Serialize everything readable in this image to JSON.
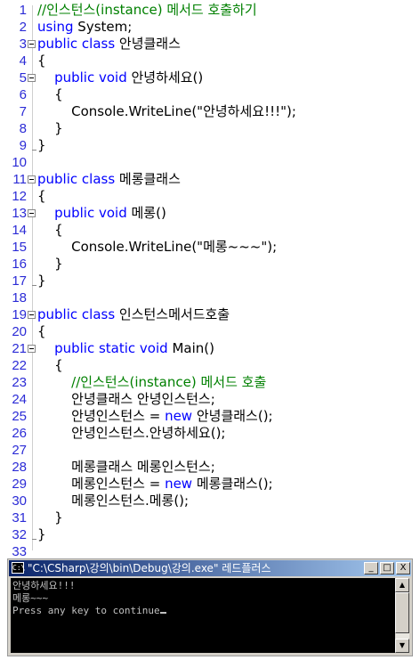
{
  "editor": {
    "lines": [
      {
        "n": "1",
        "parts": [
          {
            "t": "//인스턴스(instance) 메서드 호출하기",
            "c": "cm"
          }
        ]
      },
      {
        "n": "2",
        "parts": [
          {
            "t": "using",
            "c": "kw"
          },
          {
            "t": " System;"
          }
        ]
      },
      {
        "n": "3",
        "parts": [
          {
            "t": "public class",
            "c": "kw"
          },
          {
            "t": " 안녕클래스"
          }
        ]
      },
      {
        "n": "4",
        "parts": [
          {
            "t": "{"
          }
        ]
      },
      {
        "n": "5",
        "parts": [
          {
            "t": "    "
          },
          {
            "t": "public void",
            "c": "kw"
          },
          {
            "t": " 안녕하세요()"
          }
        ]
      },
      {
        "n": "6",
        "parts": [
          {
            "t": "    {"
          }
        ]
      },
      {
        "n": "7",
        "parts": [
          {
            "t": "        Console.WriteLine(\"안녕하세요!!!\");"
          }
        ]
      },
      {
        "n": "8",
        "parts": [
          {
            "t": "    }"
          }
        ]
      },
      {
        "n": "9",
        "parts": [
          {
            "t": "}"
          }
        ]
      },
      {
        "n": "10",
        "parts": []
      },
      {
        "n": "11",
        "parts": [
          {
            "t": "public class",
            "c": "kw"
          },
          {
            "t": " 메롱클래스"
          }
        ]
      },
      {
        "n": "12",
        "parts": [
          {
            "t": "{"
          }
        ]
      },
      {
        "n": "13",
        "parts": [
          {
            "t": "    "
          },
          {
            "t": "public void",
            "c": "kw"
          },
          {
            "t": " 메롱()"
          }
        ]
      },
      {
        "n": "14",
        "parts": [
          {
            "t": "    {"
          }
        ]
      },
      {
        "n": "15",
        "parts": [
          {
            "t": "        Console.WriteLine(\"메롱~~~\");"
          }
        ]
      },
      {
        "n": "16",
        "parts": [
          {
            "t": "    }"
          }
        ]
      },
      {
        "n": "17",
        "parts": [
          {
            "t": "}"
          }
        ]
      },
      {
        "n": "18",
        "parts": []
      },
      {
        "n": "19",
        "parts": [
          {
            "t": "public class",
            "c": "kw"
          },
          {
            "t": " 인스턴스메서드호출"
          }
        ]
      },
      {
        "n": "20",
        "parts": [
          {
            "t": "{"
          }
        ]
      },
      {
        "n": "21",
        "parts": [
          {
            "t": "    "
          },
          {
            "t": "public static void",
            "c": "kw"
          },
          {
            "t": " Main()"
          }
        ]
      },
      {
        "n": "22",
        "parts": [
          {
            "t": "    {"
          }
        ]
      },
      {
        "n": "23",
        "parts": [
          {
            "t": "        "
          },
          {
            "t": "//인스턴스(instance) 메서드 호출",
            "c": "cm"
          }
        ]
      },
      {
        "n": "24",
        "parts": [
          {
            "t": "        안녕클래스 안녕인스턴스;"
          }
        ]
      },
      {
        "n": "25",
        "parts": [
          {
            "t": "        안녕인스턴스 = "
          },
          {
            "t": "new",
            "c": "kw"
          },
          {
            "t": " 안녕클래스();"
          }
        ]
      },
      {
        "n": "26",
        "parts": [
          {
            "t": "        안녕인스턴스.안녕하세요();"
          }
        ]
      },
      {
        "n": "27",
        "parts": []
      },
      {
        "n": "28",
        "parts": [
          {
            "t": "        메롱클래스 메롱인스턴스;"
          }
        ]
      },
      {
        "n": "29",
        "parts": [
          {
            "t": "        메롱인스턴스 = "
          },
          {
            "t": "new",
            "c": "kw"
          },
          {
            "t": " 메롱클래스();"
          }
        ]
      },
      {
        "n": "30",
        "parts": [
          {
            "t": "        메롱인스턴스.메롱();"
          }
        ]
      },
      {
        "n": "31",
        "parts": [
          {
            "t": "    }"
          }
        ]
      },
      {
        "n": "32",
        "parts": [
          {
            "t": "}"
          }
        ]
      },
      {
        "n": "33",
        "parts": []
      }
    ],
    "colors": {
      "keyword": "#0000ff",
      "comment": "#008000",
      "line_number": "#2b2bd6"
    }
  },
  "console": {
    "title": "\"C:\\CSharp\\강의\\bin\\Debug\\강의.exe\" 레드플러스",
    "icon_label": "C:\\",
    "buttons": {
      "minimize": "_",
      "maximize": "□",
      "close": "X"
    },
    "output": [
      "안녕하세요!!!",
      "메롱~~~",
      "Press any key to continue"
    ]
  }
}
